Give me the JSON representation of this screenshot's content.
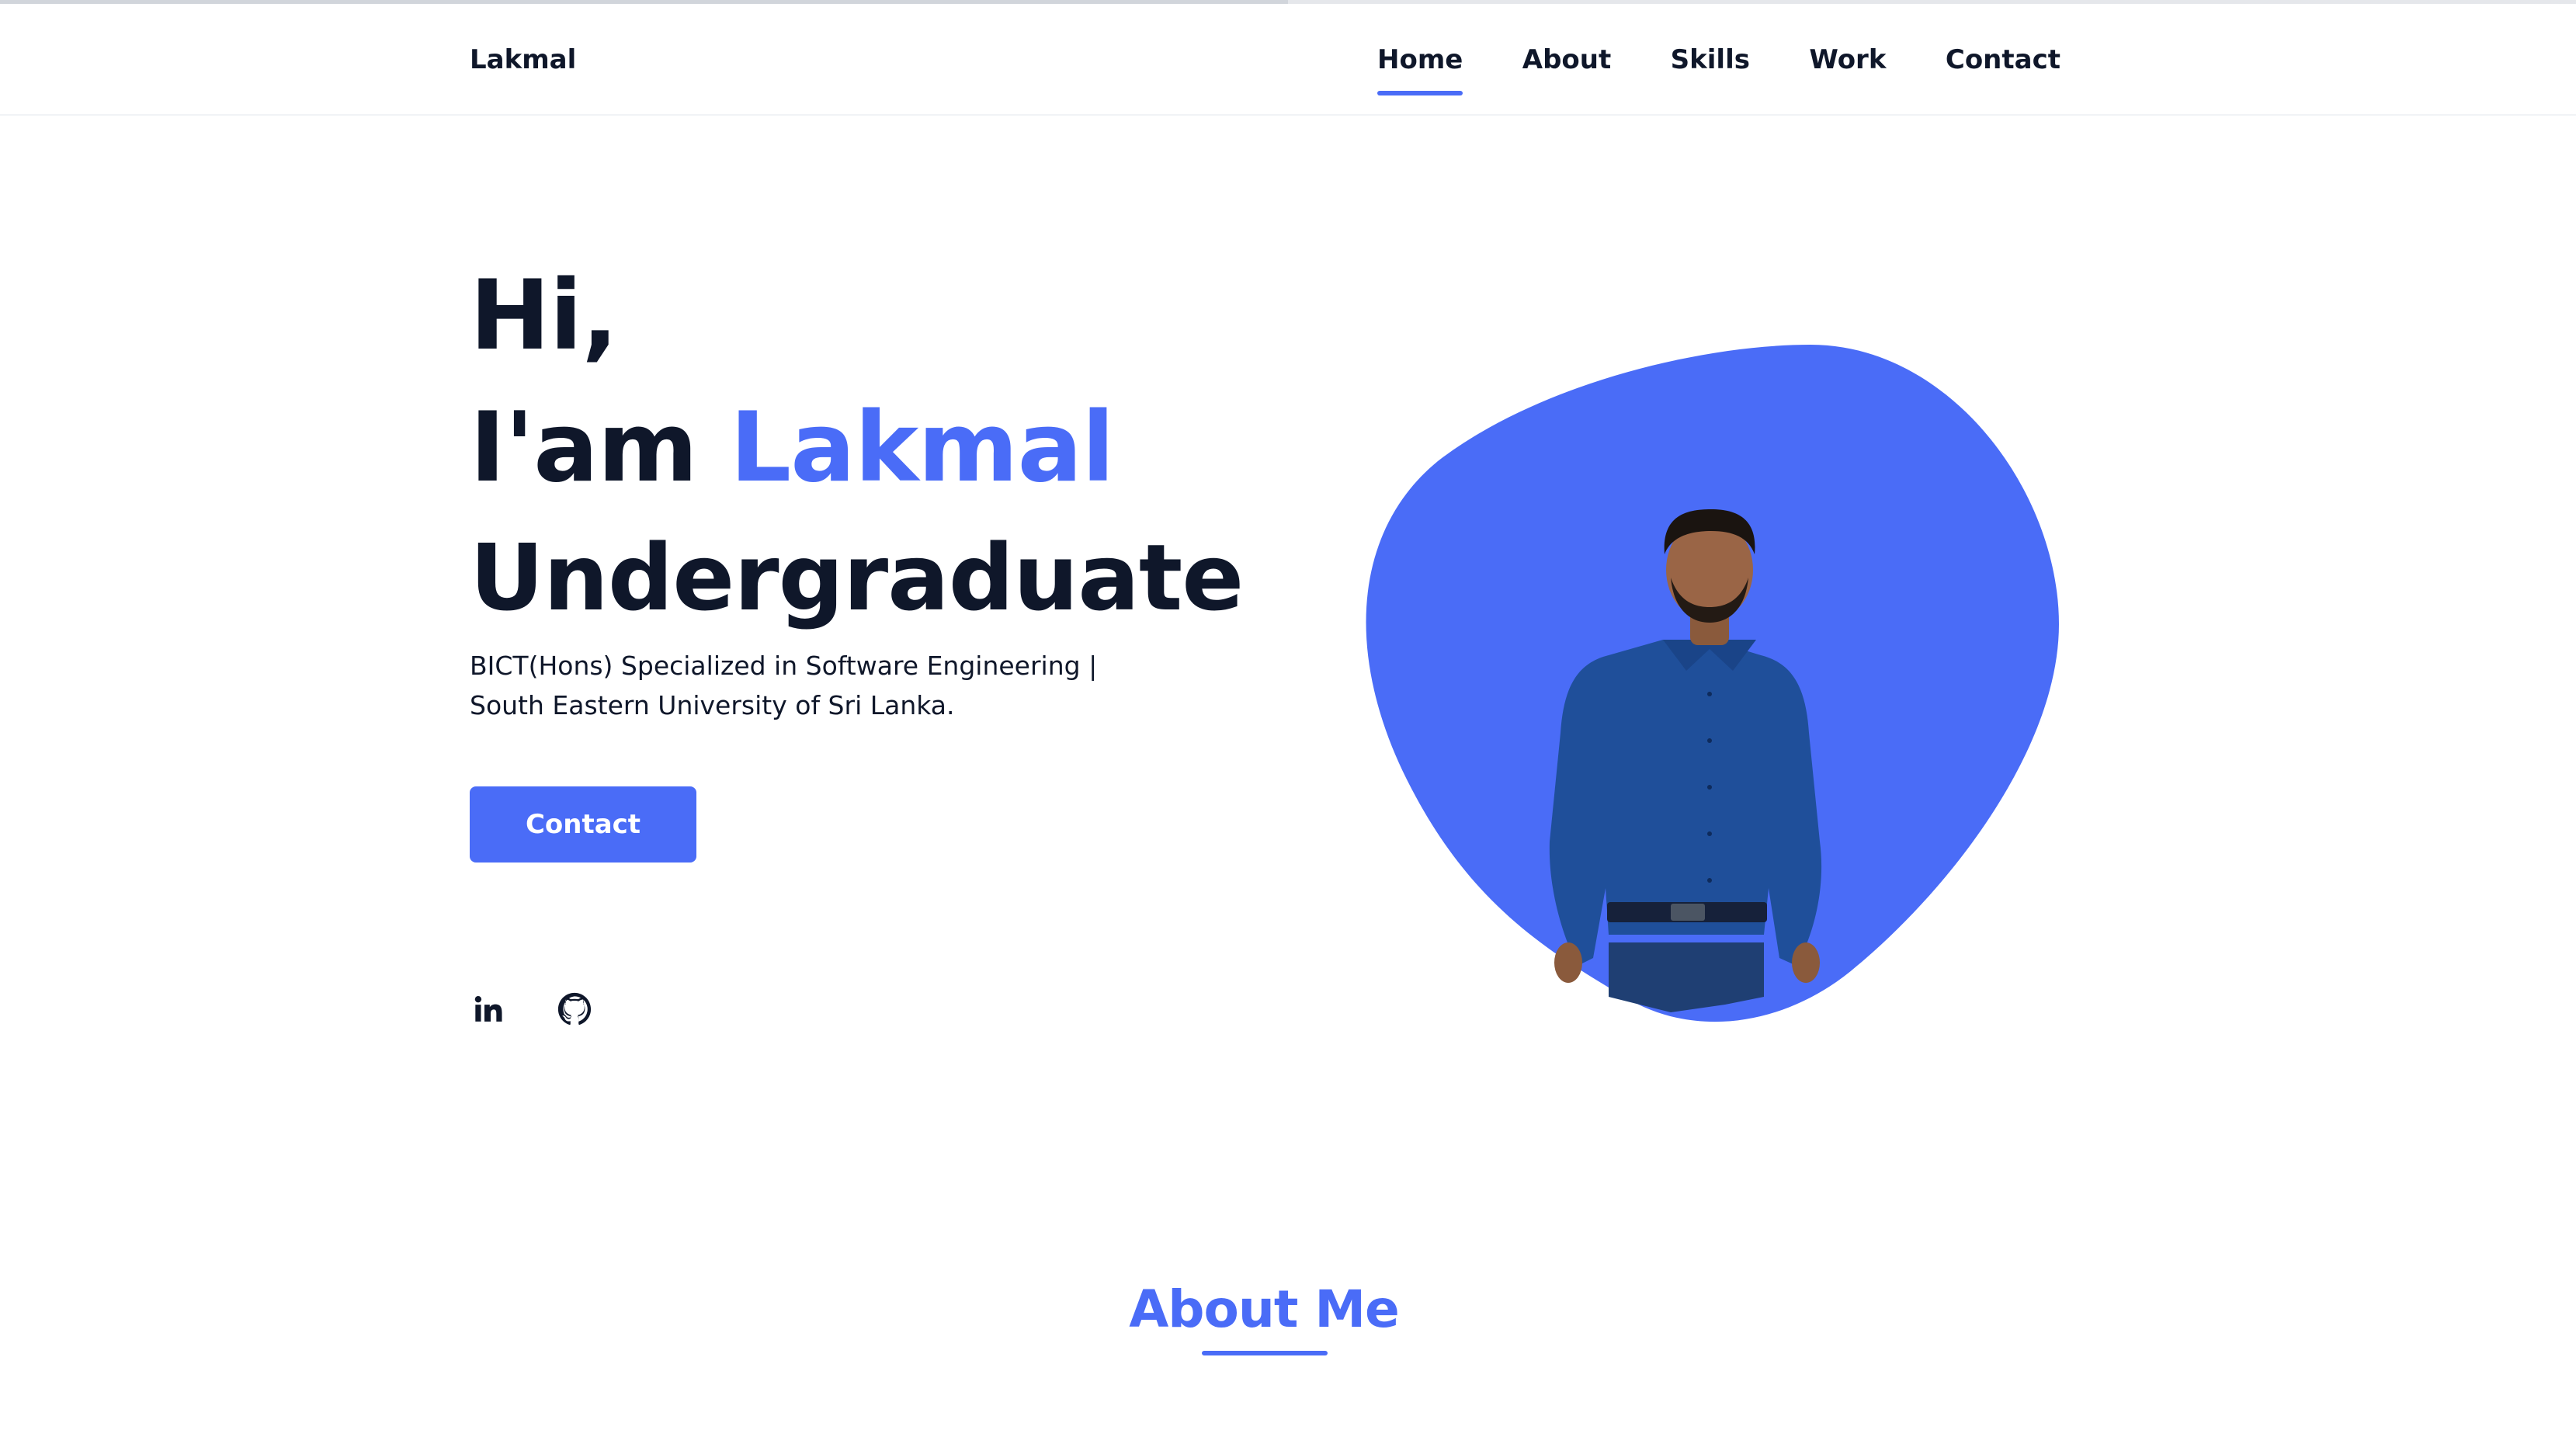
{
  "progress": {
    "value": 0.5
  },
  "nav": {
    "logo": "Lakmal",
    "items": [
      {
        "label": "Home",
        "active": true
      },
      {
        "label": "About"
      },
      {
        "label": "Skills"
      },
      {
        "label": "Work"
      },
      {
        "label": "Contact"
      }
    ]
  },
  "hero": {
    "greeting": "Hi,",
    "name_prefix": "I'am",
    "name": "Lakmal",
    "role": "Undergraduate",
    "description_line1": "BICT(Hons) Specialized in Software Engineering |",
    "description_line2": "South Eastern University of Sri Lanka.",
    "contact_button": "Contact",
    "social": [
      {
        "icon": "linkedin-icon"
      },
      {
        "icon": "github-icon"
      }
    ]
  },
  "about": {
    "title": "About Me"
  },
  "colors": {
    "accent": "#4a6cf7",
    "text": "#0f172a",
    "background": "#ffffff"
  }
}
